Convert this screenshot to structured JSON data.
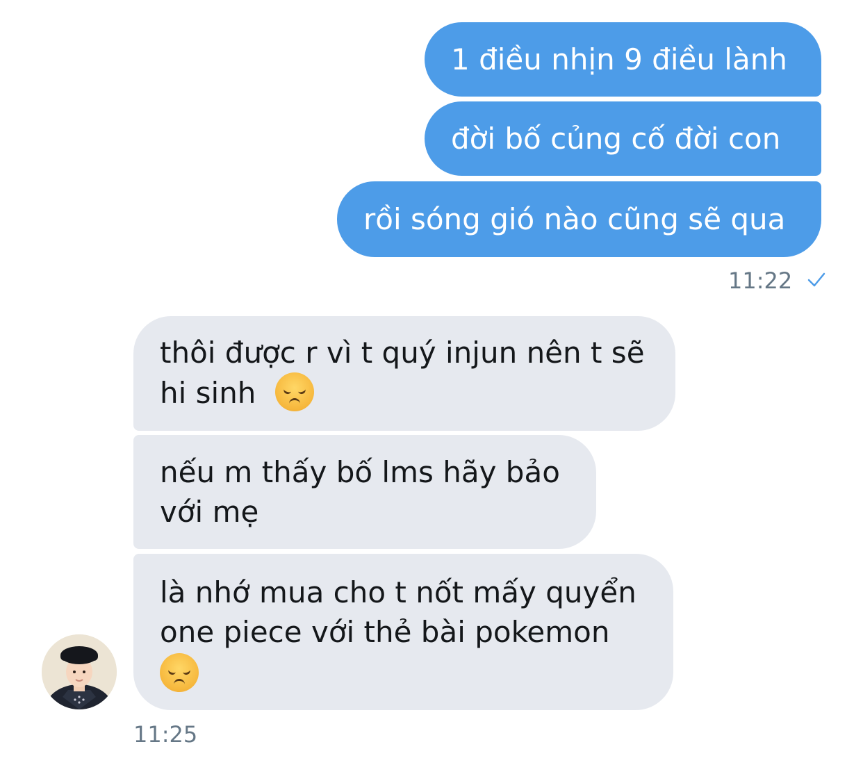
{
  "sent": {
    "messages": [
      "1 điều nhịn 9 điều lành",
      "đời bố củng cố đời con",
      "rồi sóng gió nào cũng sẽ qua"
    ],
    "time": "11:22",
    "status_icon": "checkmark-icon"
  },
  "received": {
    "messages": [
      {
        "lines": [
          "thôi được r vì t quý injun nên t sẽ",
          "hi sinh"
        ],
        "emoji": "disappointed-face"
      },
      {
        "lines": [
          "nếu m thấy bố lms hãy bảo",
          "với mẹ"
        ]
      },
      {
        "lines": [
          "là nhớ mua cho t nốt mấy quyển",
          "one piece với thẻ bài pokemon"
        ],
        "emoji": "disappointed-face"
      }
    ],
    "time": "11:25",
    "avatar": "avatar"
  },
  "colors": {
    "sent_bubble": "#4d9ce8",
    "received_bubble": "#e6e9ef",
    "timestamp": "#657786"
  }
}
